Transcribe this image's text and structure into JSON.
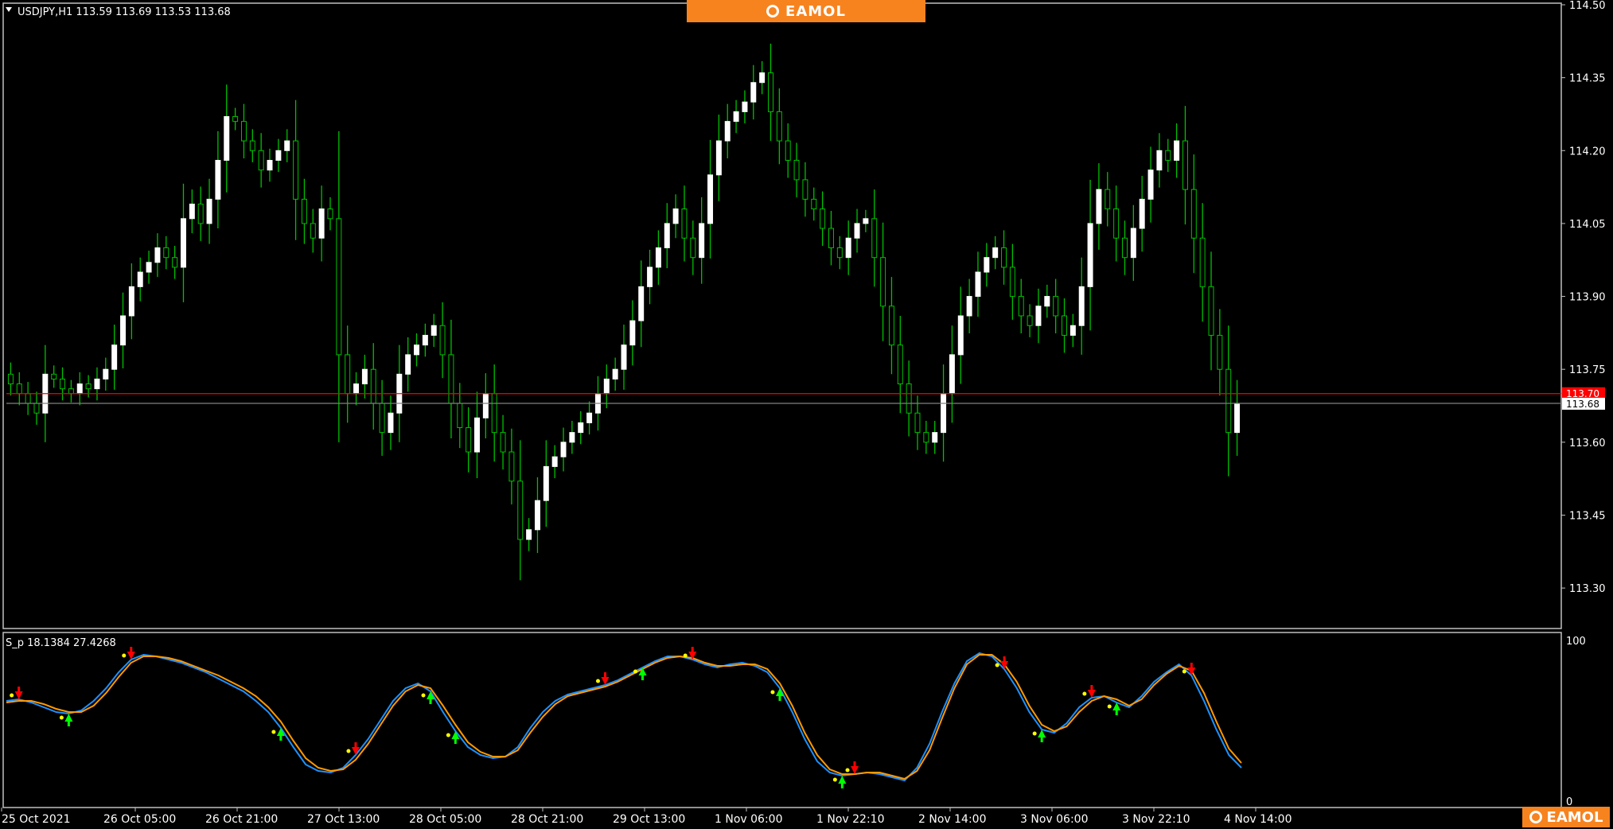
{
  "header": {
    "symbol_line": "USDJPY,H1  113.59 113.69 113.53 113.68"
  },
  "banner": {
    "brand": "EAMOL",
    "logo_icon": "eamol-ring-icon"
  },
  "corner_logo": {
    "brand": "EAMOL"
  },
  "indicator": {
    "label": "S_p 18.1384 27.4268",
    "level_top": "100",
    "level_bottom": "0"
  },
  "colors": {
    "bull_candle": "#ffffff",
    "bear_candle": "#00c000",
    "wick": "#00c000",
    "bid_line": "#ff0000",
    "ask_line": "#808080",
    "stoch_main": "#1e90ff",
    "stoch_signal": "#ff9900",
    "buy_arrow": "#00ff00",
    "sell_arrow": "#ff0000",
    "dot": "#ffff00"
  },
  "chart_data": [
    {
      "type": "candlestick",
      "ylim": [
        113.22,
        114.5
      ],
      "yticks": [
        "114.50",
        "114.35",
        "114.20",
        "114.05",
        "113.90",
        "113.75",
        "113.60",
        "113.45",
        "113.30"
      ],
      "price_labels": {
        "bid": "113.70",
        "current": "113.68"
      },
      "bid_price": 113.7,
      "current_price": 113.68,
      "xticks": [
        "25 Oct 2021",
        "26 Oct 05:00",
        "26 Oct 21:00",
        "27 Oct 13:00",
        "28 Oct 05:00",
        "28 Oct 21:00",
        "29 Oct 13:00",
        "1 Nov 06:00",
        "1 Nov 22:10",
        "2 Nov 14:00",
        "3 Nov 06:00",
        "3 Nov 22:10",
        "4 Nov 14:00"
      ],
      "close": [
        113.72,
        113.7,
        113.68,
        113.66,
        113.74,
        113.73,
        113.71,
        113.7,
        113.72,
        113.71,
        113.73,
        113.75,
        113.8,
        113.86,
        113.92,
        113.95,
        113.97,
        114.0,
        113.98,
        113.96,
        114.06,
        114.09,
        114.05,
        114.1,
        114.18,
        114.27,
        114.26,
        114.22,
        114.2,
        114.16,
        114.18,
        114.2,
        114.22,
        114.1,
        114.05,
        114.02,
        114.08,
        114.06,
        113.78,
        113.7,
        113.72,
        113.75,
        113.68,
        113.62,
        113.66,
        113.74,
        113.78,
        113.8,
        113.82,
        113.84,
        113.78,
        113.68,
        113.63,
        113.58,
        113.65,
        113.7,
        113.62,
        113.58,
        113.52,
        113.4,
        113.42,
        113.48,
        113.55,
        113.57,
        113.6,
        113.62,
        113.64,
        113.66,
        113.7,
        113.73,
        113.75,
        113.8,
        113.85,
        113.92,
        113.96,
        114.0,
        114.05,
        114.08,
        114.02,
        113.98,
        114.05,
        114.15,
        114.22,
        114.26,
        114.28,
        114.3,
        114.34,
        114.36,
        114.28,
        114.22,
        114.18,
        114.14,
        114.1,
        114.08,
        114.04,
        114.0,
        113.98,
        114.02,
        114.05,
        114.06,
        113.98,
        113.88,
        113.8,
        113.72,
        113.66,
        113.62,
        113.6,
        113.62,
        113.7,
        113.78,
        113.86,
        113.9,
        113.95,
        113.98,
        114.0,
        113.96,
        113.9,
        113.86,
        113.84,
        113.88,
        113.9,
        113.86,
        113.82,
        113.84,
        113.92,
        114.05,
        114.12,
        114.08,
        114.02,
        113.98,
        114.04,
        114.1,
        114.16,
        114.2,
        114.18,
        114.22,
        114.12,
        114.02,
        113.92,
        113.82,
        113.75,
        113.62,
        113.68
      ]
    },
    {
      "type": "line",
      "title": "S_p 18.1384 27.4268",
      "ylim": [
        0,
        100
      ],
      "series": [
        {
          "name": "",
          "values": [
            62,
            63,
            61,
            58,
            55,
            54,
            56,
            62,
            70,
            80,
            88,
            91,
            90,
            88,
            86,
            83,
            80,
            76,
            72,
            68,
            62,
            55,
            45,
            33,
            22,
            18,
            17,
            20,
            28,
            38,
            50,
            62,
            70,
            73,
            68,
            55,
            43,
            33,
            28,
            26,
            27,
            33,
            45,
            55,
            62,
            66,
            68,
            70,
            72,
            75,
            79,
            83,
            87,
            90,
            90,
            88,
            85,
            83,
            85,
            86,
            84,
            80,
            70,
            55,
            38,
            24,
            17,
            15,
            16,
            17,
            16,
            14,
            12,
            20,
            35,
            55,
            73,
            87,
            92,
            90,
            82,
            70,
            55,
            44,
            42,
            48,
            58,
            64,
            65,
            61,
            58,
            65,
            74,
            80,
            85,
            78,
            62,
            44,
            28,
            20
          ]
        },
        {
          "name": "",
          "values": [
            61,
            62,
            62,
            60,
            57,
            55,
            55,
            59,
            67,
            77,
            86,
            90,
            90,
            89,
            87,
            84,
            81,
            78,
            74,
            70,
            65,
            58,
            49,
            37,
            26,
            20,
            18,
            19,
            25,
            35,
            47,
            59,
            68,
            72,
            70,
            59,
            47,
            36,
            30,
            27,
            27,
            31,
            42,
            52,
            60,
            65,
            67,
            69,
            71,
            74,
            78,
            82,
            86,
            89,
            90,
            89,
            86,
            84,
            84,
            85,
            85,
            82,
            73,
            59,
            42,
            28,
            19,
            16,
            16,
            17,
            17,
            15,
            13,
            18,
            31,
            51,
            70,
            85,
            91,
            91,
            85,
            74,
            59,
            47,
            43,
            46,
            55,
            62,
            65,
            63,
            59,
            63,
            72,
            79,
            84,
            81,
            67,
            49,
            32,
            23
          ]
        }
      ],
      "sell_signals": [
        1,
        10,
        28,
        48,
        55,
        68,
        80,
        87,
        95
      ],
      "buy_signals": [
        5,
        22,
        34,
        36,
        51,
        62,
        67,
        83,
        89
      ]
    }
  ]
}
